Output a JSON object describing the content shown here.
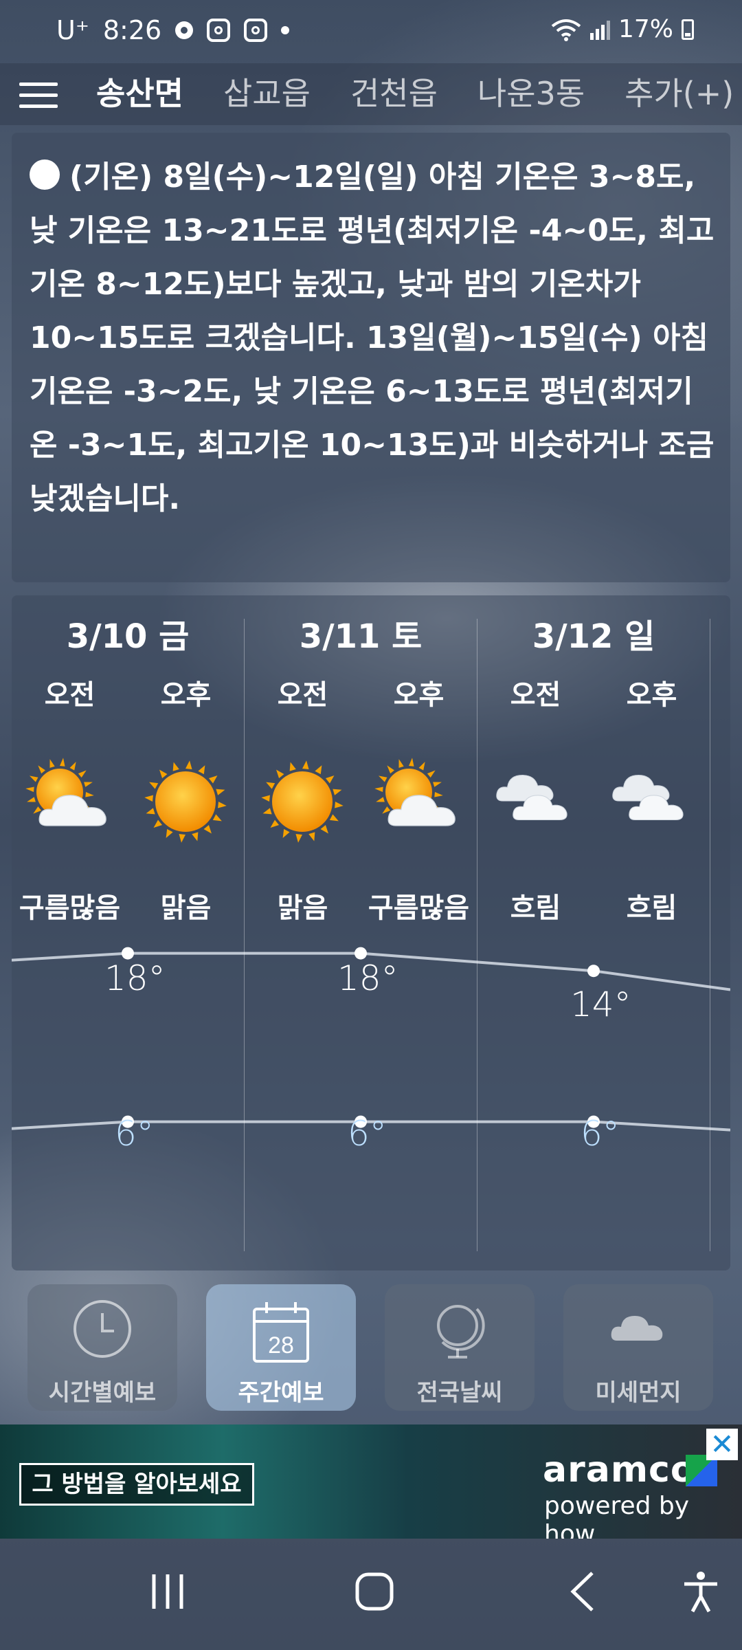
{
  "status_bar": {
    "carrier": "U⁺",
    "time": "8:26",
    "battery": "17%"
  },
  "header": {
    "tabs": [
      {
        "label": "송산면",
        "active": true
      },
      {
        "label": "삽교읍",
        "active": false
      },
      {
        "label": "건천읍",
        "active": false
      },
      {
        "label": "나운3동",
        "active": false
      },
      {
        "label": "추가(+)",
        "active": false
      }
    ]
  },
  "forecast_text": {
    "body": "(기온) 8일(수)~12일(일) 아침 기온은 3~8도, 낮 기온은 13~21도로 평년(최저기온 -4~0도, 최고기온 8~12도)보다 높겠고, 낮과 밤의 기온차가 10~15도로 크겠습니다. 13일(월)~15일(수) 아침 기온은 -3~2도, 낮 기온은 6~13도로 평년(최저기온 -3~1도, 최고기온 10~13도)과 비슷하거나 조금 낮겠습니다."
  },
  "weekly": {
    "days": [
      {
        "date": "3/10 금",
        "am": {
          "label": "오전",
          "icon": "partly-cloudy-icon",
          "condition": "구름많음"
        },
        "pm": {
          "label": "오후",
          "icon": "sunny-icon",
          "condition": "맑음"
        },
        "high": "18°",
        "low": "6°"
      },
      {
        "date": "3/11 토",
        "am": {
          "label": "오전",
          "icon": "sunny-icon",
          "condition": "맑음"
        },
        "pm": {
          "label": "오후",
          "icon": "partly-cloudy-icon",
          "condition": "구름많음"
        },
        "high": "18°",
        "low": "6°"
      },
      {
        "date": "3/12 일",
        "am": {
          "label": "오전",
          "icon": "cloudy-icon",
          "condition": "흐림"
        },
        "pm": {
          "label": "오후",
          "icon": "cloudy-icon",
          "condition": "흐림"
        },
        "high": "14°",
        "low": "6°"
      }
    ]
  },
  "bottom_nav": {
    "items": [
      {
        "label": "시간별예보",
        "icon": "clock-icon",
        "active": false
      },
      {
        "label": "주간예보",
        "icon": "calendar-icon",
        "calendar_day": "28",
        "active": true
      },
      {
        "label": "전국날씨",
        "icon": "globe-icon",
        "active": false
      },
      {
        "label": "미세먼지",
        "icon": "cloud-icon",
        "active": false
      }
    ]
  },
  "ad": {
    "cta": "그 방법을 알아보세요",
    "brand": "aramco",
    "tagline": "powered by how",
    "close": "✕"
  },
  "colors": {
    "low_temp": "#bde0ff",
    "active_tab_bg": "#aac8e6"
  }
}
